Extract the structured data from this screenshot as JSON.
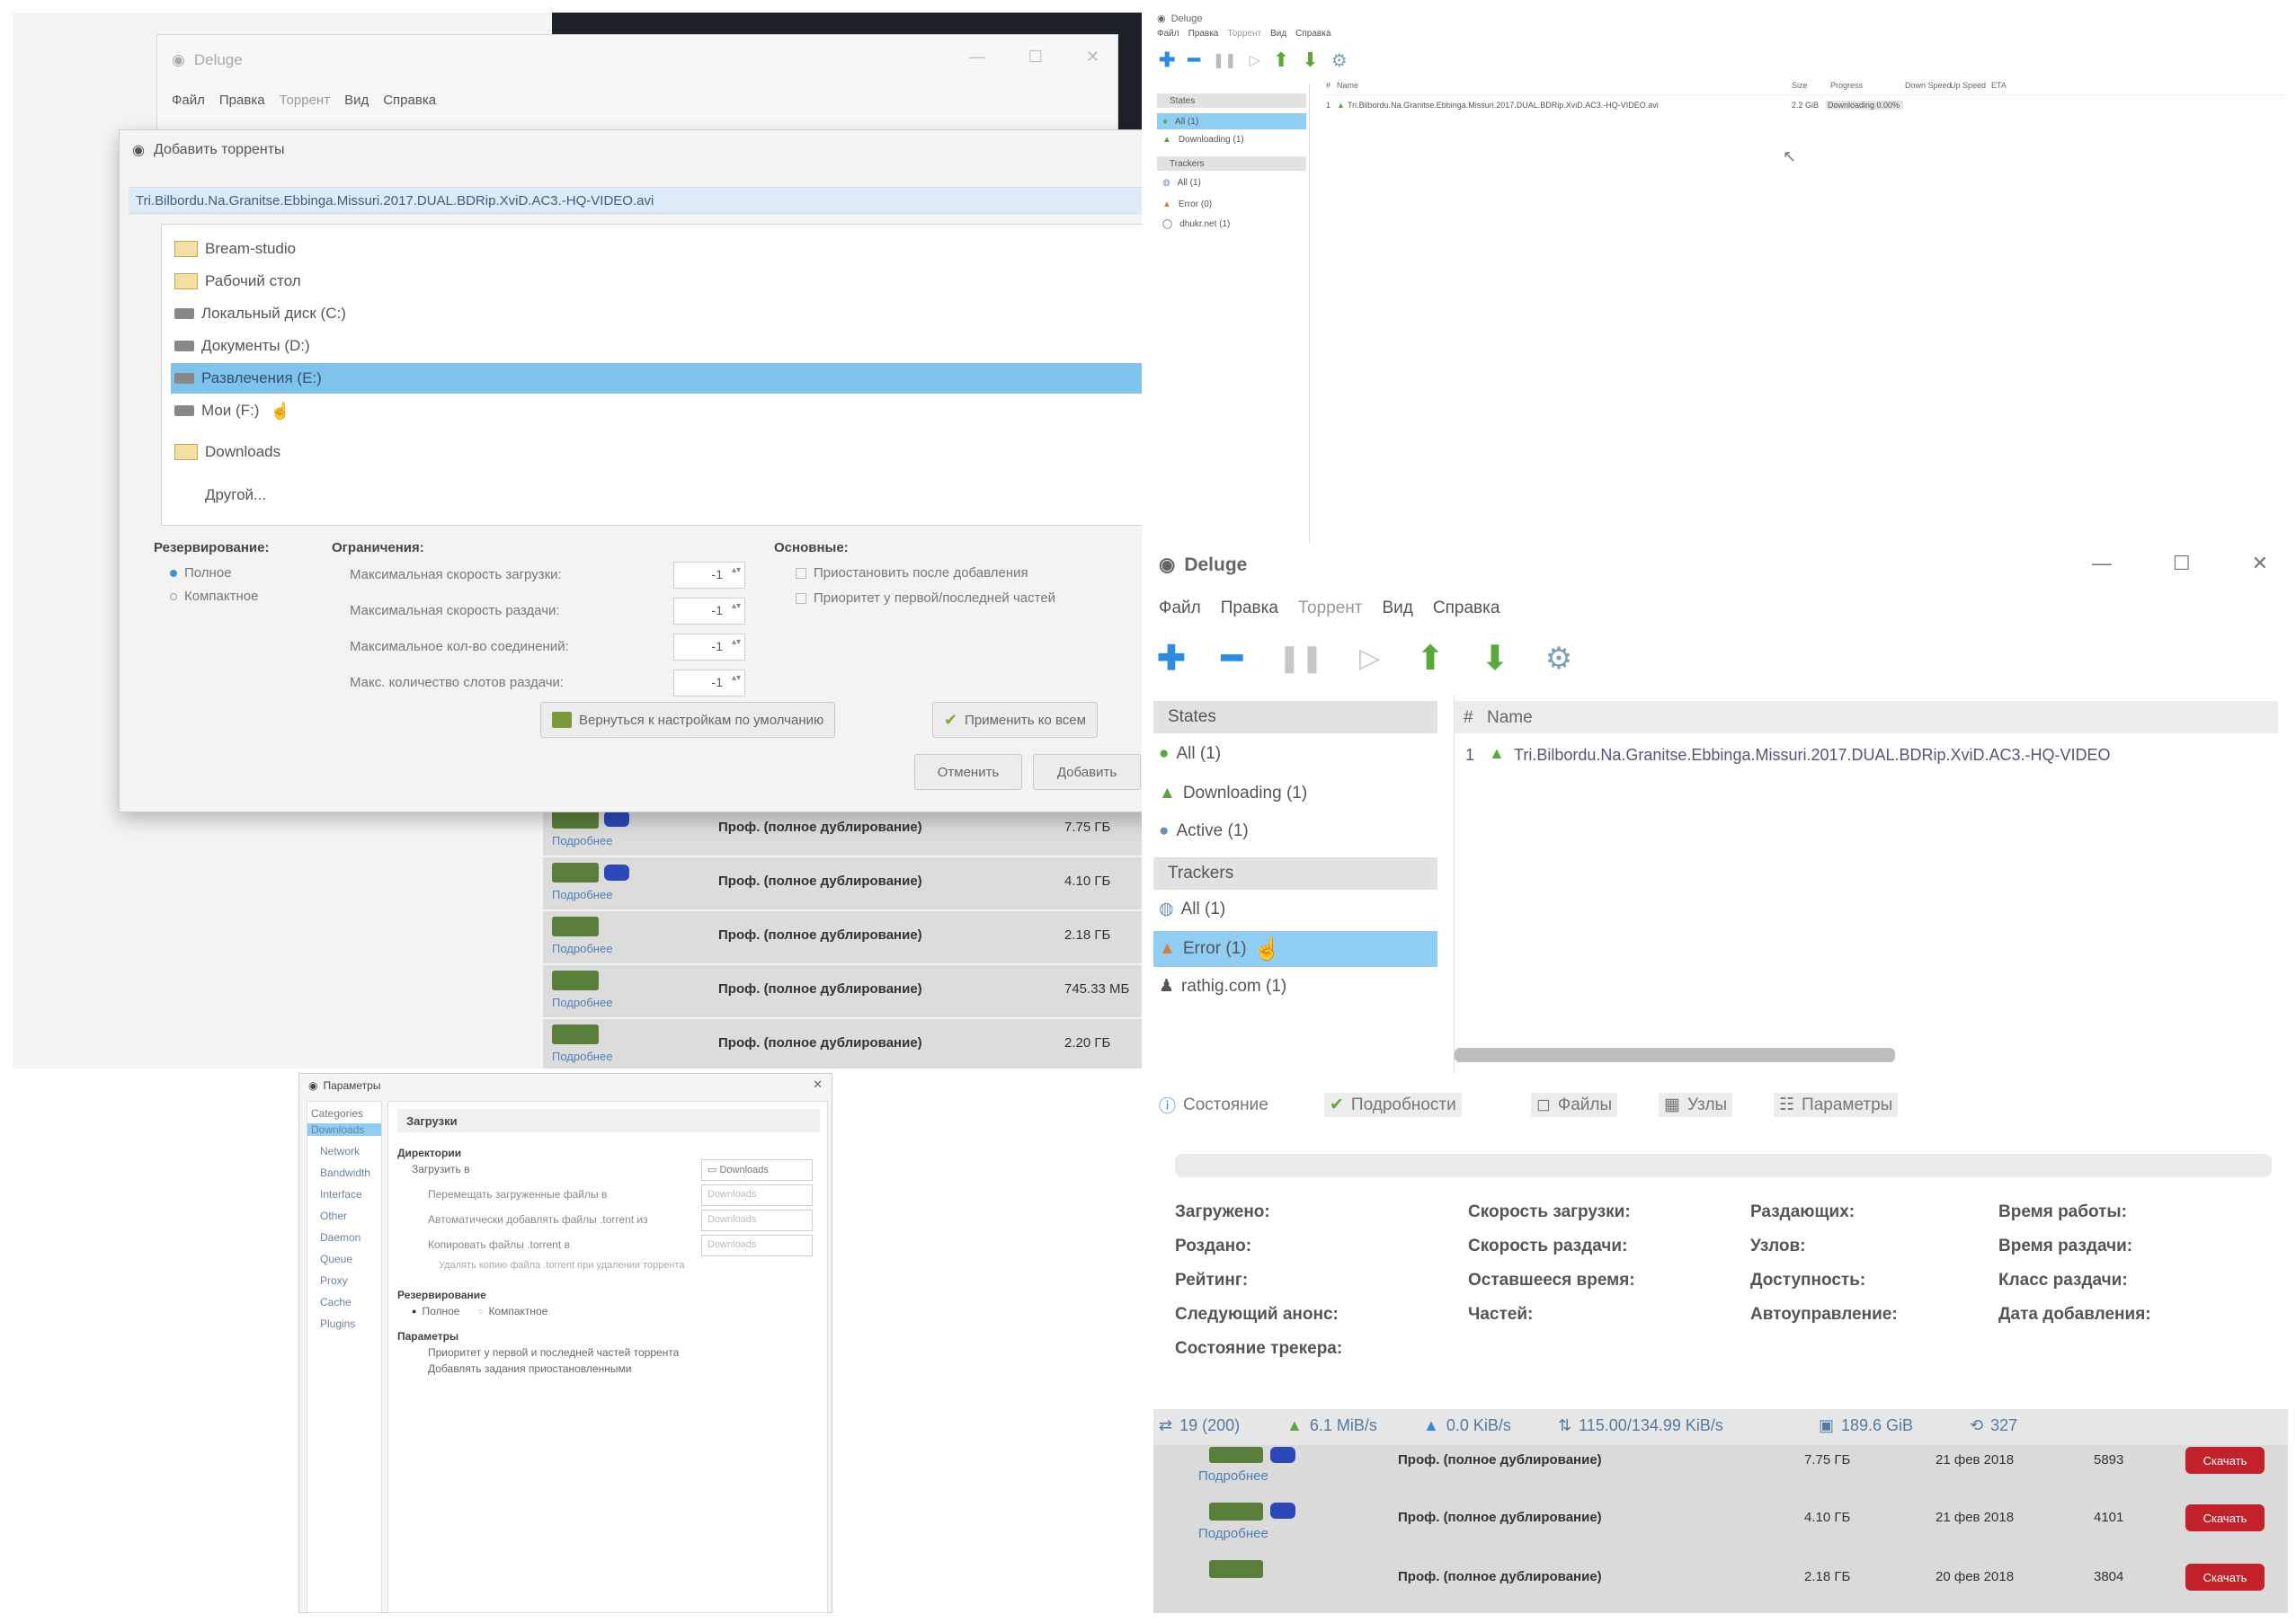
{
  "panel1": {
    "bg_window": {
      "title": "Deluge",
      "menu": [
        "Файл",
        "Правка",
        "Торрент",
        "Вид",
        "Справка"
      ]
    },
    "dialog": {
      "title": "Добавить торренты",
      "torrent_file": "Tri.Bilbordu.Na.Granitse.Ebbinga.Missuri.2017.DUAL.BDRip.XviD.AC3.-HQ-VIDEO.avi",
      "dropdown_items": [
        "Bream-studio",
        "Рабочий стол",
        "Локальный диск (C:)",
        "Документы (D:)",
        "Развлечения (E:)",
        "Мои (F:)",
        "Downloads",
        "Другой..."
      ],
      "allocation_label": "Резервирование:",
      "allocation_options": [
        "Полное",
        "Компактное"
      ],
      "limits_label": "Ограничения:",
      "limits": [
        {
          "label": "Максимальная скорость загрузки:",
          "value": "-1"
        },
        {
          "label": "Максимальная скорость раздачи:",
          "value": "-1"
        },
        {
          "label": "Максимальное кол-во соединений:",
          "value": "-1"
        },
        {
          "label": "Макс. количество слотов раздачи:",
          "value": "-1"
        }
      ],
      "general_label": "Основные:",
      "general_options": [
        "Приостановить после добавления",
        "Приоритет у первой/последней частей"
      ],
      "revert_button": "Вернуться к настройкам по умолчанию",
      "apply_all_button": "Применить ко всем",
      "cancel_button": "Отменить",
      "add_button": "Добавить"
    },
    "site_rows": [
      {
        "sub": "Подробнее",
        "title": "Проф. (полное дублирование)",
        "size": "7.75 ГБ"
      },
      {
        "sub": "Подробнее",
        "title": "Проф. (полное дублирование)",
        "size": "4.10 ГБ"
      },
      {
        "sub": "Подробнее",
        "title": "Проф. (полное дублирование)",
        "size": "2.18 ГБ"
      },
      {
        "sub": "Подробнее",
        "title": "Проф. (полное дублирование)",
        "size": "745.33 МБ"
      },
      {
        "sub": "Подробнее",
        "title": "Проф. (полное дублирование)",
        "size": "2.20 ГБ"
      }
    ]
  },
  "panel2": {
    "title": "Deluge",
    "menu": [
      "Файл",
      "Правка",
      "Торрент",
      "Вид",
      "Справка"
    ],
    "sidebar_states_header": "States",
    "sidebar_states": [
      "All (1)",
      "Downloading (1)"
    ],
    "sidebar_trackers_header": "Trackers",
    "sidebar_trackers": [
      "All (1)",
      "Error (0)",
      "dhukr.net (1)"
    ],
    "columns": [
      "#",
      "Name",
      "Size",
      "Progress",
      "Down Speed",
      "Up Speed",
      "ETA"
    ],
    "rows": [
      {
        "num": "1",
        "name": "Tri.Bilbordu.Na.Granitse.Ebbinga.Missuri.2017.DUAL.BDRip.XviD.AC3.-HQ-VIDEO.avi",
        "size": "2.2 GiB",
        "progress": "Downloading 0.00%"
      }
    ]
  },
  "panel3": {
    "title": "Deluge",
    "menu": [
      "Файл",
      "Правка",
      "Торрент",
      "Вид",
      "Справка"
    ],
    "sidebar_states_header": "States",
    "sidebar_states": [
      "All (1)",
      "Downloading (1)",
      "Active (1)"
    ],
    "sidebar_trackers_header": "Trackers",
    "sidebar_trackers": [
      "All (1)",
      "Error (1)",
      "rathig.com (1)"
    ],
    "col_num": "#",
    "col_name": "Name",
    "row": {
      "num": "1",
      "name": "Tri.Bilbordu.Na.Granitse.Ebbinga.Missuri.2017.DUAL.BDRip.XviD.AC3.-HQ-VIDEO"
    },
    "tabs": [
      "Состояние",
      "Подробности",
      "Файлы",
      "Узлы",
      "Параметры"
    ],
    "status_labels": [
      [
        "Загружено:",
        "Скорость загрузки:",
        "Раздающих:",
        "Время работы:"
      ],
      [
        "Роздано:",
        "Скорость раздачи:",
        "Узлов:",
        "Время раздачи:"
      ],
      [
        "Рейтинг:",
        "Оставшееся время:",
        "Доступность:",
        "Класс раздачи:"
      ],
      [
        "Следующий анонс:",
        "Частей:",
        "Автоуправление:",
        "Дата добавления:"
      ],
      [
        "Состояние трекера:"
      ]
    ],
    "statusbar": {
      "connections": "19 (200)",
      "down": "6.1 MiB/s",
      "up": "0.0 KiB/s",
      "protocol": "115.00/134.99 KiB/s",
      "disk": "189.6 GiB",
      "dht": "327"
    },
    "site_rows": [
      {
        "sub": "Подробнее",
        "title": "Проф. (полное дублирование)",
        "size": "7.75 ГБ",
        "date": "21 фев 2018",
        "count": "5893",
        "button": "Скачать"
      },
      {
        "sub": "Подробнее",
        "title": "Проф. (полное дублирование)",
        "size": "4.10 ГБ",
        "date": "21 фев 2018",
        "count": "4101",
        "button": "Скачать"
      },
      {
        "sub": "Подробнее",
        "title": "Проф. (полное дублирование)",
        "size": "2.18 ГБ",
        "date": "20 фев 2018",
        "count": "3804",
        "button": "Скачать"
      }
    ]
  },
  "panel4": {
    "title": "Параметры",
    "categories": [
      "Categories",
      "Downloads",
      "Network",
      "Bandwidth",
      "Interface",
      "Other",
      "Daemon",
      "Queue",
      "Proxy",
      "Cache",
      "Plugins"
    ],
    "section_title": "Загрузки",
    "folders_header": "Директории",
    "download_to_label": "Загрузить в",
    "download_to_value": "Downloads",
    "move_completed_label": "Перемещать загруженные файлы в",
    "auto_add_label": "Автоматически добавлять файлы .torrent из",
    "copy_torrent_label": "Копировать файлы .torrent в",
    "delete_copy_label": "Удалять копию файла .torrent при удалении торрента",
    "disabled_value": "Downloads",
    "allocation_header": "Резервирование",
    "allocation_options": [
      "Полное",
      "Компактное"
    ],
    "options_header": "Параметры",
    "options": [
      "Приоритет у первой и последней частей торрента",
      "Добавлять задания приостановленными"
    ]
  },
  "colors": {
    "selection": "#8fcdf2",
    "download_green": "#5aa83a",
    "upload_blue": "#2f8be0",
    "red_button": "#c0212b"
  }
}
